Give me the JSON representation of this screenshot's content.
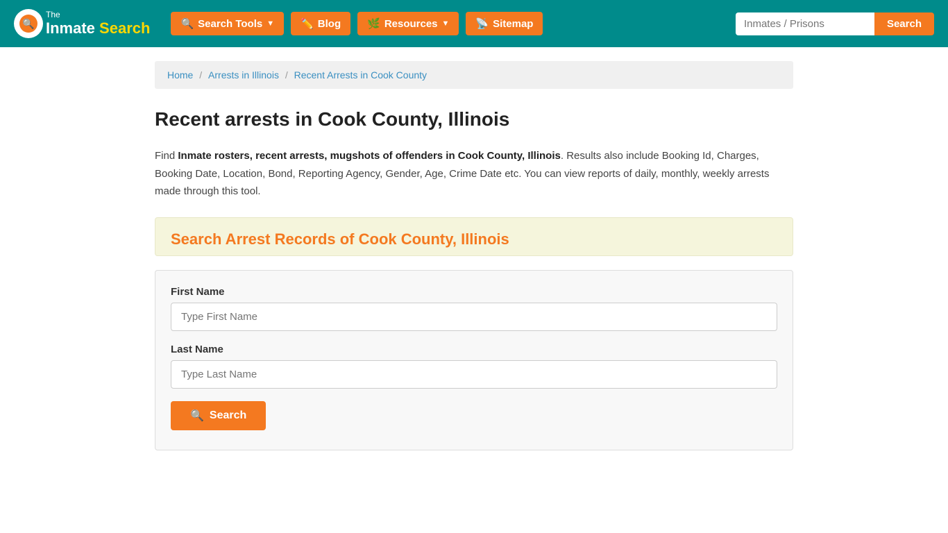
{
  "navbar": {
    "logo": {
      "the": "The",
      "inmate": "Inmate",
      "search": "Search"
    },
    "nav_items": [
      {
        "id": "search-tools",
        "label": "Search Tools",
        "dropdown": true,
        "icon": "🔍"
      },
      {
        "id": "blog",
        "label": "Blog",
        "dropdown": false,
        "icon": "✏️"
      },
      {
        "id": "resources",
        "label": "Resources",
        "dropdown": true,
        "icon": "🌿"
      },
      {
        "id": "sitemap",
        "label": "Sitemap",
        "dropdown": false,
        "icon": "📡"
      }
    ],
    "search_placeholder": "Inmates / Prisons",
    "search_btn_label": "Search"
  },
  "breadcrumb": {
    "home": "Home",
    "level1": "Arrests in Illinois",
    "level2": "Recent Arrests in Cook County"
  },
  "page": {
    "title": "Recent arrests in Cook County, Illinois",
    "description_start": "Find ",
    "description_bold": "Inmate rosters, recent arrests, mugshots of offenders in Cook County, Illinois",
    "description_end": ". Results also include Booking Id, Charges, Booking Date, Location, Bond, Reporting Agency, Gender, Age, Crime Date etc. You can view reports of daily, monthly, weekly arrests made through this tool."
  },
  "search_form": {
    "section_title": "Search Arrest Records of Cook County, Illinois",
    "first_name_label": "First Name",
    "first_name_placeholder": "Type First Name",
    "last_name_label": "Last Name",
    "last_name_placeholder": "Type Last Name",
    "submit_label": "Search"
  }
}
